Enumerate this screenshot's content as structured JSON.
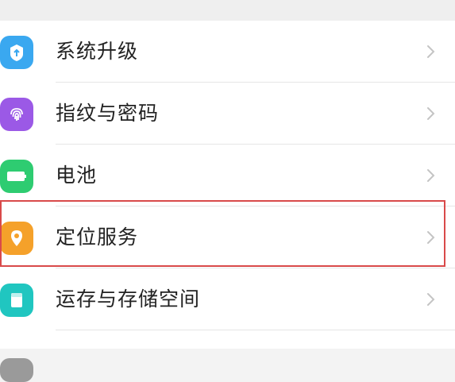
{
  "settings": {
    "items": [
      {
        "label": "系统升级",
        "icon": "system-update-icon",
        "color": "#3aa8f0"
      },
      {
        "label": "指纹与密码",
        "icon": "fingerprint-icon",
        "color": "#9b59e6"
      },
      {
        "label": "电池",
        "icon": "battery-icon",
        "color": "#2ecc71"
      },
      {
        "label": "定位服务",
        "icon": "location-pin-icon",
        "color": "#f5a12a"
      },
      {
        "label": "运存与存储空间",
        "icon": "storage-icon",
        "color": "#20c6c0"
      }
    ],
    "highlight_color": "#d94a4a"
  }
}
